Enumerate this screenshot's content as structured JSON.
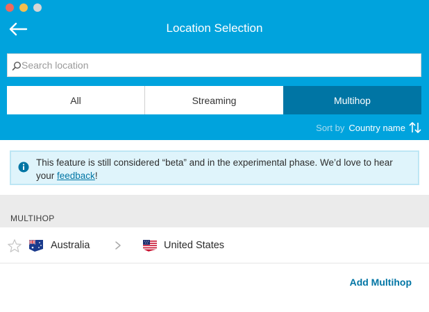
{
  "header": {
    "title": "Location Selection",
    "back_icon": "arrow-left-icon",
    "bg_color": "#00a3dd"
  },
  "search": {
    "placeholder": "Search location",
    "value": ""
  },
  "tabs": [
    {
      "label": "All",
      "active": false
    },
    {
      "label": "Streaming",
      "active": false
    },
    {
      "label": "Multihop",
      "active": true
    }
  ],
  "sort": {
    "label": "Sort by",
    "value": "Country name"
  },
  "notice": {
    "text_before": "This feature is still considered “beta” and in the experimental phase. We’d love to hear your ",
    "link_text": "feedback",
    "text_after": "!"
  },
  "section": {
    "title": "MULTIHOP"
  },
  "multihop_rows": [
    {
      "entry": "Australia",
      "exit": "United States",
      "favorite": false
    }
  ],
  "actions": {
    "add_label": "Add Multihop"
  },
  "colors": {
    "accent": "#0075a4",
    "notice_bg": "#dff4fb"
  }
}
